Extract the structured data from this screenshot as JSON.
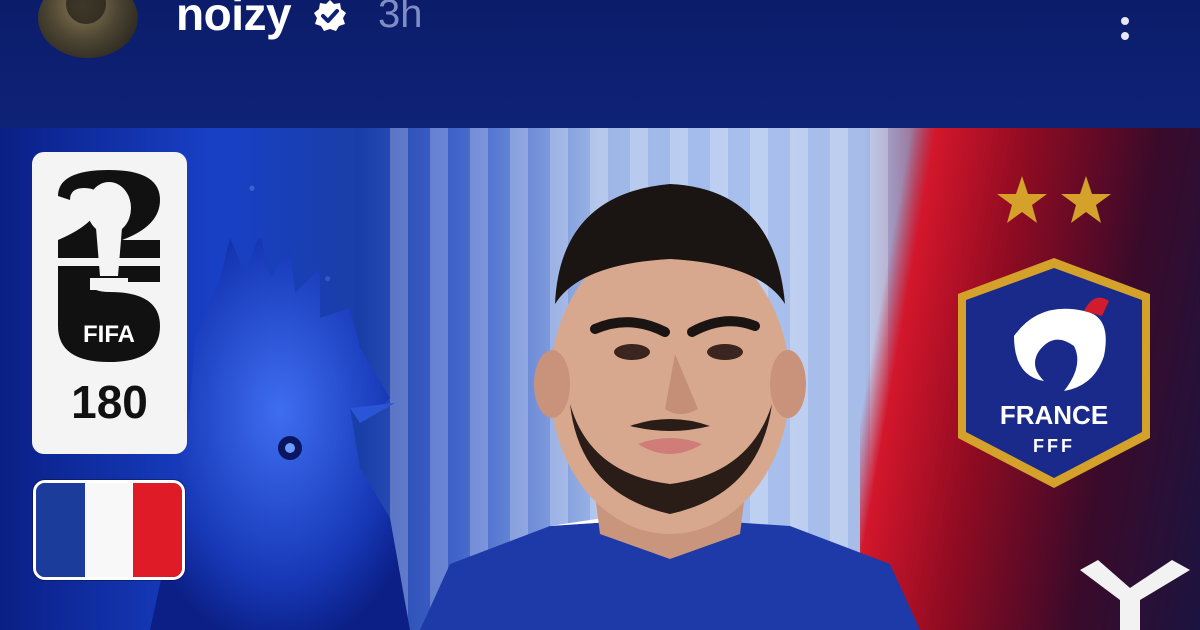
{
  "post_header": {
    "username": "noizy",
    "verified_icon": "verified-badge-icon",
    "timestamp": "3h",
    "more_icon": "more-vertical-icon"
  },
  "post_image": {
    "fifa_badge": {
      "logo_text": "FIFA",
      "count": "180"
    },
    "flag_icon": "france-flag-icon",
    "crest": {
      "country": "FRANCE",
      "federation": "FFF"
    }
  },
  "colors": {
    "header_bg": "#0b1c6a",
    "flag_blue": "#1c3c9c",
    "flag_white": "#f8f8f8",
    "flag_red": "#e01b28",
    "crest_gold": "#d4a12b"
  }
}
